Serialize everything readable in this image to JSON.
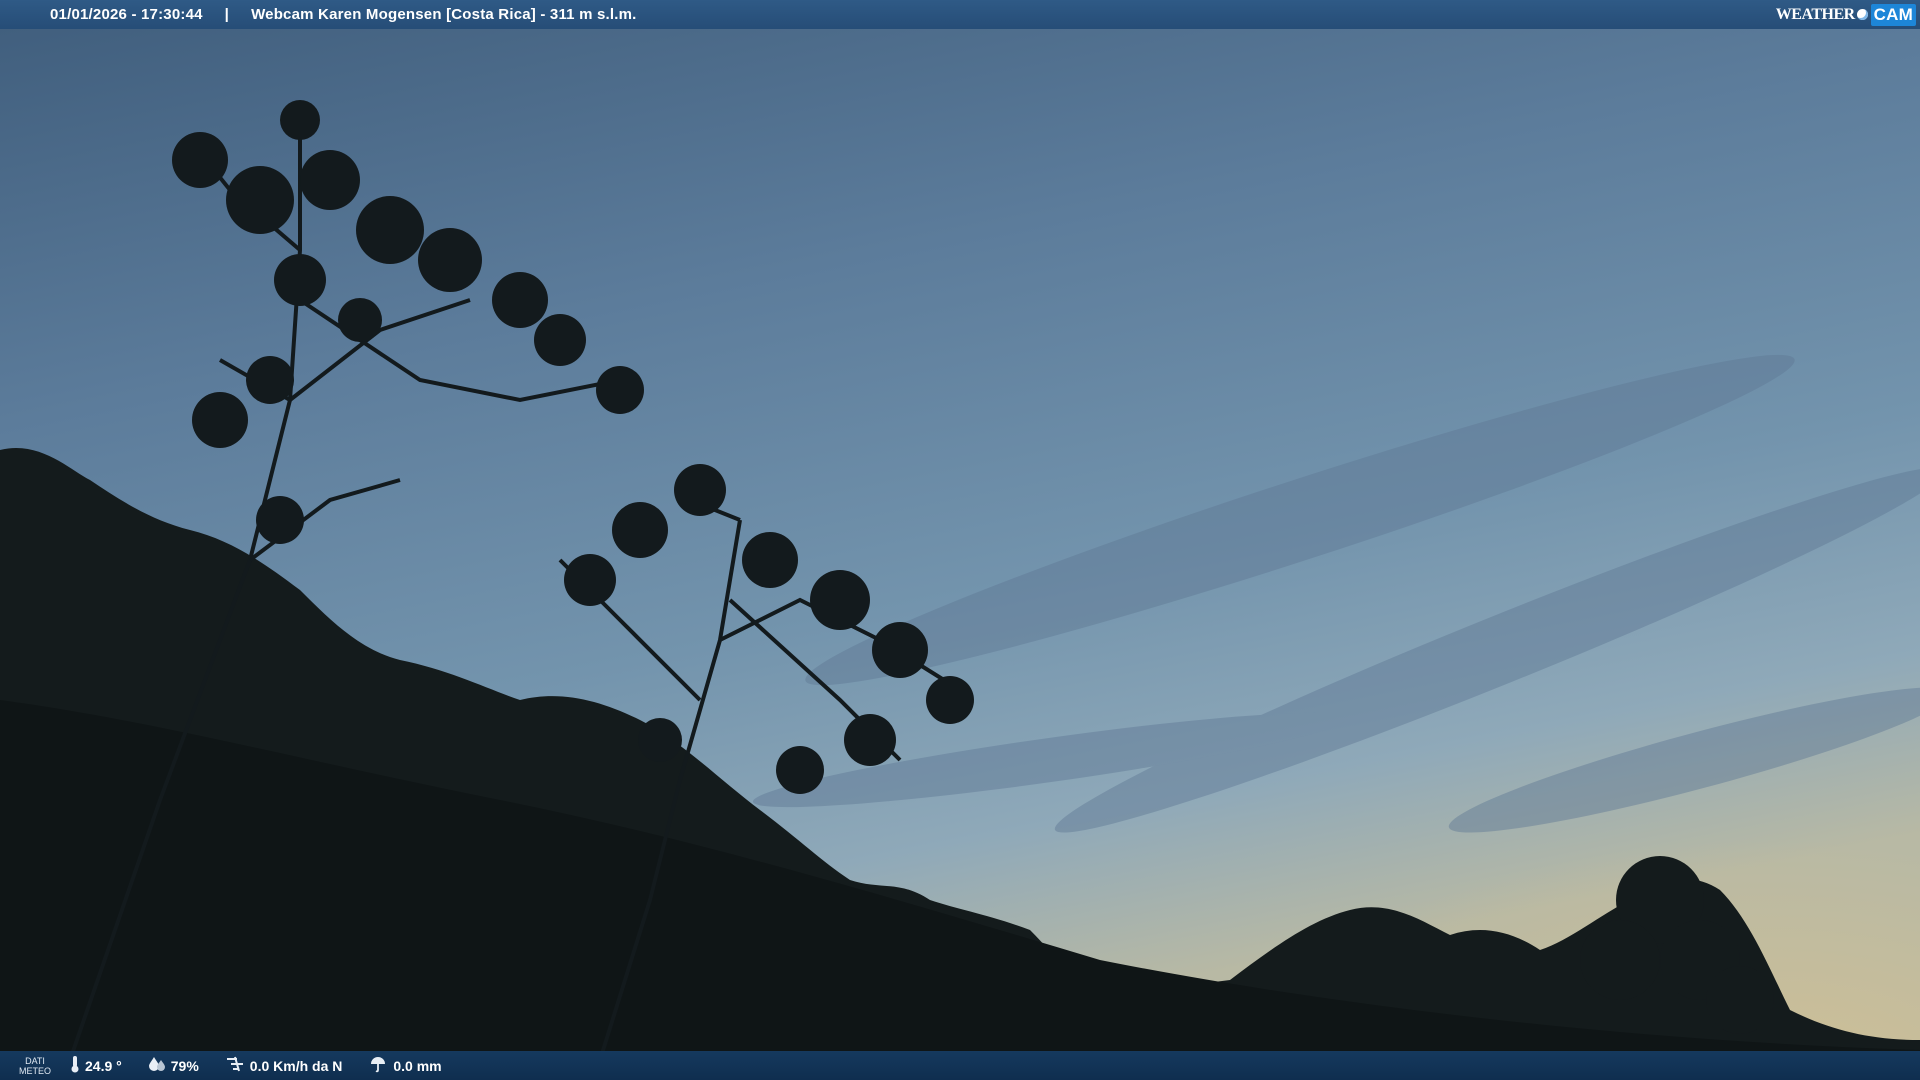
{
  "header": {
    "timestamp": "01/01/2026 - 17:30:44",
    "separator": "|",
    "title": "Webcam Karen Mogensen [Costa Rica] - 311 m s.l.m.",
    "logo_weather": "WEATHER",
    "logo_cam": "CAM"
  },
  "weather_bar": {
    "label_line1": "DATI",
    "label_line2": "METEO",
    "temperature": "24.9 °",
    "humidity": "79%",
    "wind": "0.0 Km/h da N",
    "rain": "0.0 mm"
  },
  "colors": {
    "bar_top": "#2b5581",
    "bar_bottom": "#12345a",
    "logo_cam_bg": "#1d86d8"
  },
  "icons": {
    "temperature": "thermometer-icon",
    "humidity": "humidity-icon",
    "wind": "wind-icon",
    "rain": "rain-icon"
  }
}
